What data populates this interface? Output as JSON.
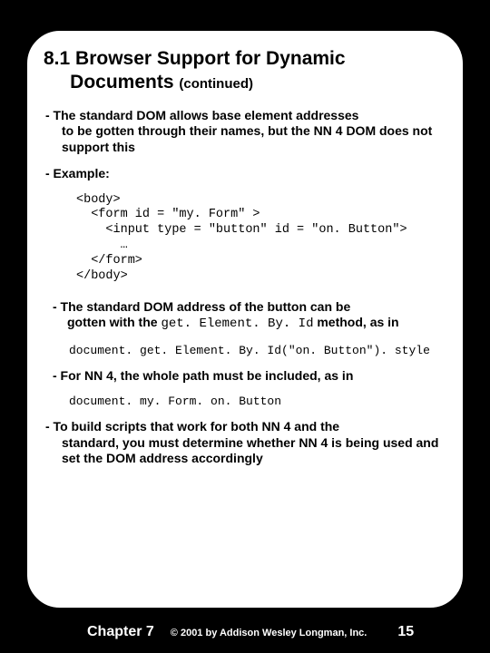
{
  "title_main": "8.1 Browser Support for Dynamic",
  "title_line2_indent": "     Documents ",
  "title_cont": "(continued)",
  "bullet1_first": "- The standard DOM allows base element addresses",
  "bullet1_rest": "to be gotten through their names, but the NN 4 DOM does not support this",
  "bullet_example": "- Example:",
  "code_block": "<body>\n  <form id = \"my. Form\" >\n    <input type = \"button\" id = \"on. Button\">\n      …\n  </form>\n</body>",
  "bullet2_first": "- The standard DOM address of the button can be",
  "bullet2_rest_a": "gotten with the ",
  "bullet2_mono": "get. Element. By. Id",
  "bullet2_rest_b": " method, as in",
  "code_line1": "document. get. Element. By. Id(\"on. Button\"). style",
  "bullet3": "- For NN 4, the whole path must be included, as in",
  "code_line2": "document. my. Form. on. Button",
  "bullet4_first": "- To build scripts that work for both NN 4 and the",
  "bullet4_rest": "standard, you must determine whether NN 4 is being used and set the DOM address accordingly",
  "footer_chapter": "Chapter 7",
  "footer_copy": "© 2001 by Addison Wesley Longman, Inc.",
  "footer_page": "15"
}
